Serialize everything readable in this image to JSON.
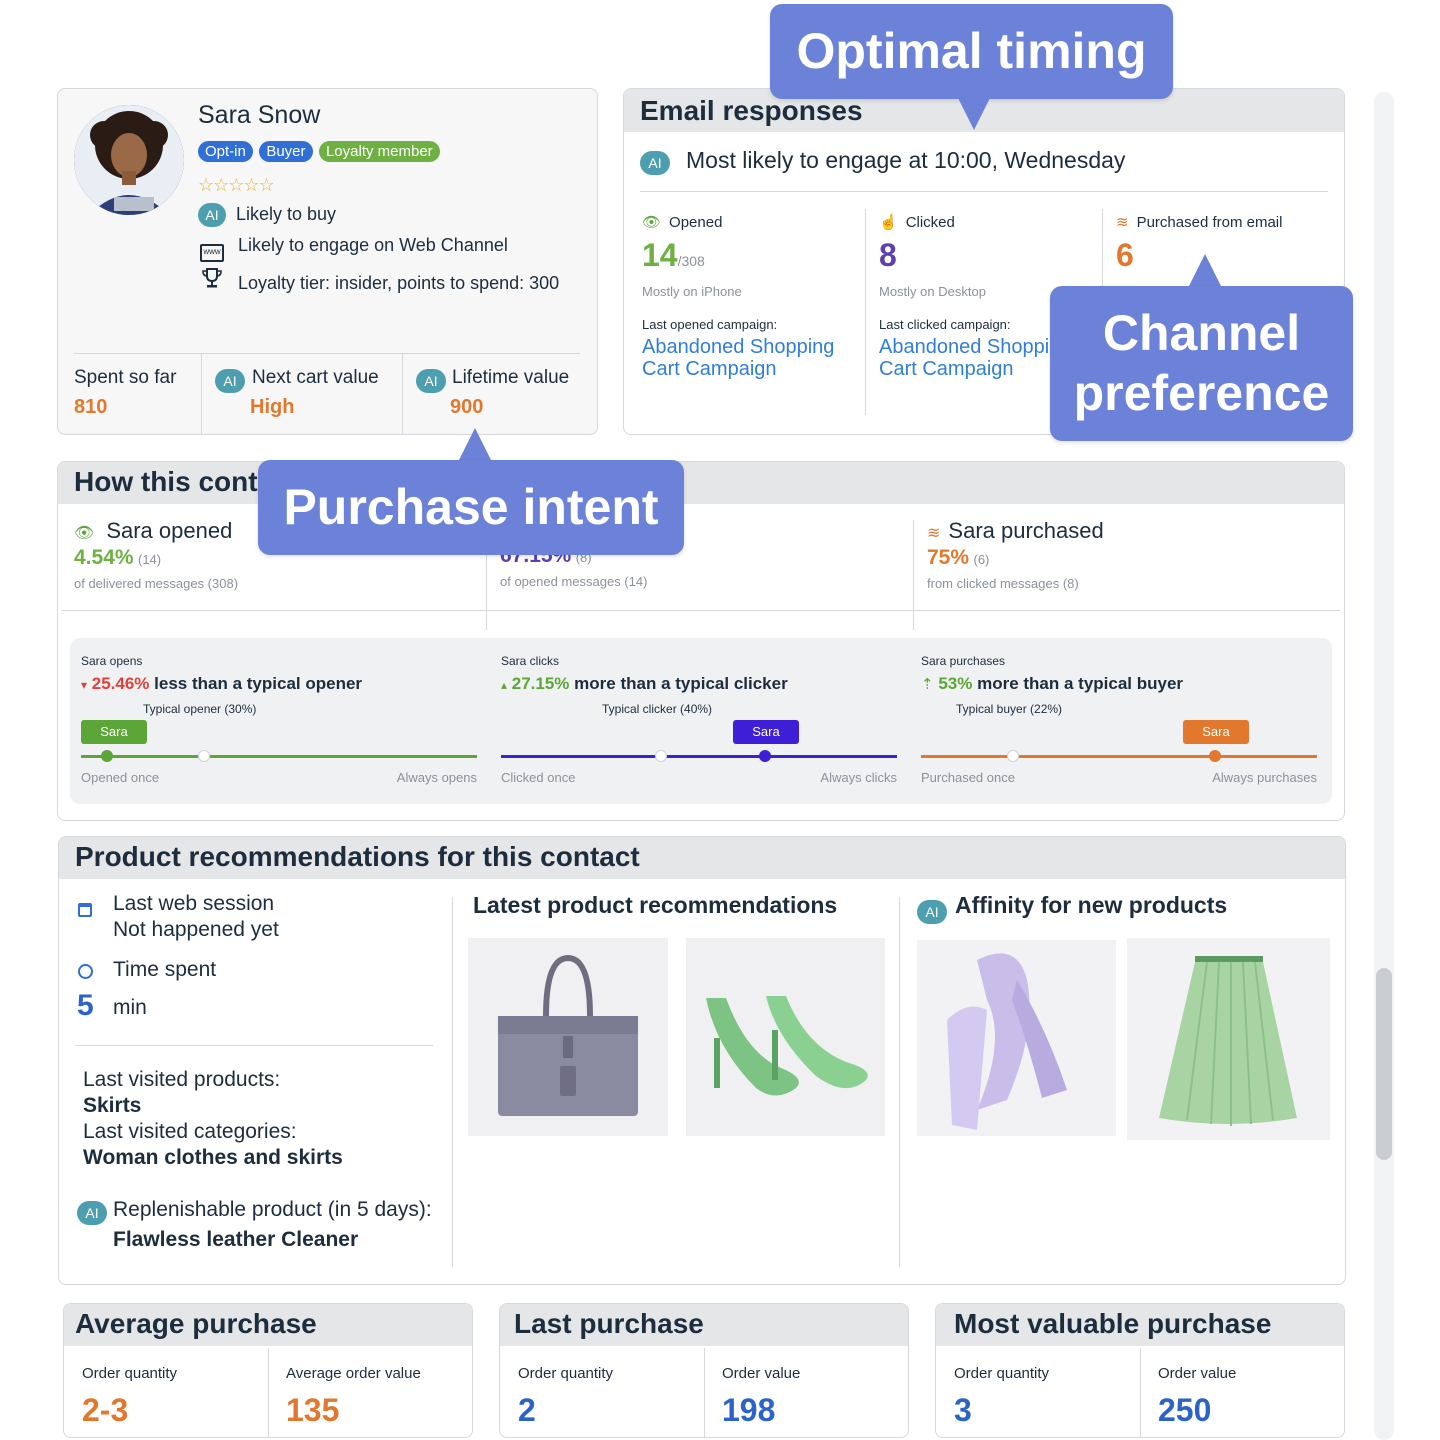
{
  "callouts": {
    "timing": "Optimal timing",
    "channel_line1": "Channel",
    "channel_line2": "preference",
    "intent": "Purchase intent"
  },
  "profile": {
    "name": "Sara Snow",
    "badges": [
      {
        "label": "Opt-in",
        "color": "#2f6fd6"
      },
      {
        "label": "Buyer",
        "color": "#2f6fd6"
      },
      {
        "label": "Loyalty member",
        "color": "#6eb142"
      }
    ],
    "stars": "☆☆☆☆☆",
    "ai_label": "AI",
    "insights": [
      {
        "icon": "ai-badge",
        "text": "Likely to buy"
      },
      {
        "icon": "web-icon",
        "text": "Likely to engage on Web Channel"
      },
      {
        "icon": "trophy-icon",
        "text": "Loyalty tier: insider, points to spend: 300"
      }
    ],
    "spent_label": "Spent so far",
    "spent_value": "810",
    "next_cart_label": "Next cart value",
    "next_cart_value": "High",
    "lifetime_label": "Lifetime value",
    "lifetime_value": "900"
  },
  "email": {
    "title": "Email responses",
    "engage_text": "Most likely to engage at 10:00, Wednesday",
    "opened": {
      "label": "Opened",
      "value": "14",
      "total": "/308",
      "note": "Mostly on iPhone",
      "campaign_label": "Last opened campaign:",
      "campaign_line1": "Abandoned Shopping",
      "campaign_line2": "Cart Campaign"
    },
    "clicked": {
      "label": "Clicked",
      "value": "8",
      "note": "Mostly on Desktop",
      "campaign_label": "Last clicked campaign:",
      "campaign_line1": "Abandoned Shoppi",
      "campaign_line2": "Cart Campaign"
    },
    "purchased": {
      "label": "Purchased from email",
      "value": "6"
    }
  },
  "how": {
    "title": "How this conta",
    "opened": {
      "label": "Sara opened",
      "value": "4.54%",
      "count": "(14)",
      "note": "of delivered messages (308)"
    },
    "clicked": {
      "value": "67.15%",
      "count": "(8)",
      "note": "of opened messages (14)"
    },
    "purchased": {
      "label": "Sara purchased",
      "value": "75%",
      "count": "(6)",
      "note": "from clicked messages (8)"
    },
    "compare": [
      {
        "title": "Sara opens",
        "arrow": "▾",
        "pct": "25.46%",
        "text": "less than a typical opener",
        "typical": "Typical opener (30%)",
        "flag": "Sara",
        "left": "Opened once",
        "right": "Always opens",
        "color": "#5ba637",
        "pct_color": "#e0413a"
      },
      {
        "title": "Sara clicks",
        "arrow": "▴",
        "pct": "27.15%",
        "text": "more than a typical clicker",
        "typical": "Typical clicker (40%)",
        "flag": "Sara",
        "left": "Clicked once",
        "right": "Always clicks",
        "color": "#3f1fd6",
        "pct_color": "#5ba637"
      },
      {
        "title": "Sara purchases",
        "arrow": "⇡",
        "pct": "53%",
        "text": "more than a typical buyer",
        "typical": "Typical buyer (22%)",
        "flag": "Sara",
        "left": "Purchased once",
        "right": "Always purchases",
        "color": "#e2782d",
        "pct_color": "#5ba637"
      }
    ]
  },
  "products": {
    "title": "Product recommendations for this contact",
    "last_session_label": "Last web session",
    "last_session_value": "Not happened yet",
    "time_spent_label": "Time spent",
    "time_spent_value": "5",
    "time_spent_unit": "min",
    "last_visited_products_label": "Last visited products:",
    "last_visited_products": "Skirts",
    "last_visited_categories_label": "Last visited categories:",
    "last_visited_categories": "Woman clothes and skirts",
    "replenish_label": "Replenishable product (in 5 days):",
    "replenish_value": "Flawless leather Cleaner",
    "latest_title": "Latest product recommendations",
    "affinity_title": "Affinity for new products"
  },
  "summary": [
    {
      "title": "Average purchase",
      "qty_label": "Order quantity",
      "qty": "2-3",
      "val_label": "Average order value",
      "val": "135",
      "color": "#e2782d"
    },
    {
      "title": "Last purchase",
      "qty_label": "Order quantity",
      "qty": "2",
      "val_label": "Order value",
      "val": "198",
      "color": "#2b63c9"
    },
    {
      "title": "Most valuable purchase",
      "qty_label": "Order quantity",
      "qty": "3",
      "val_label": "Order value",
      "val": "250",
      "color": "#2b63c9"
    }
  ]
}
